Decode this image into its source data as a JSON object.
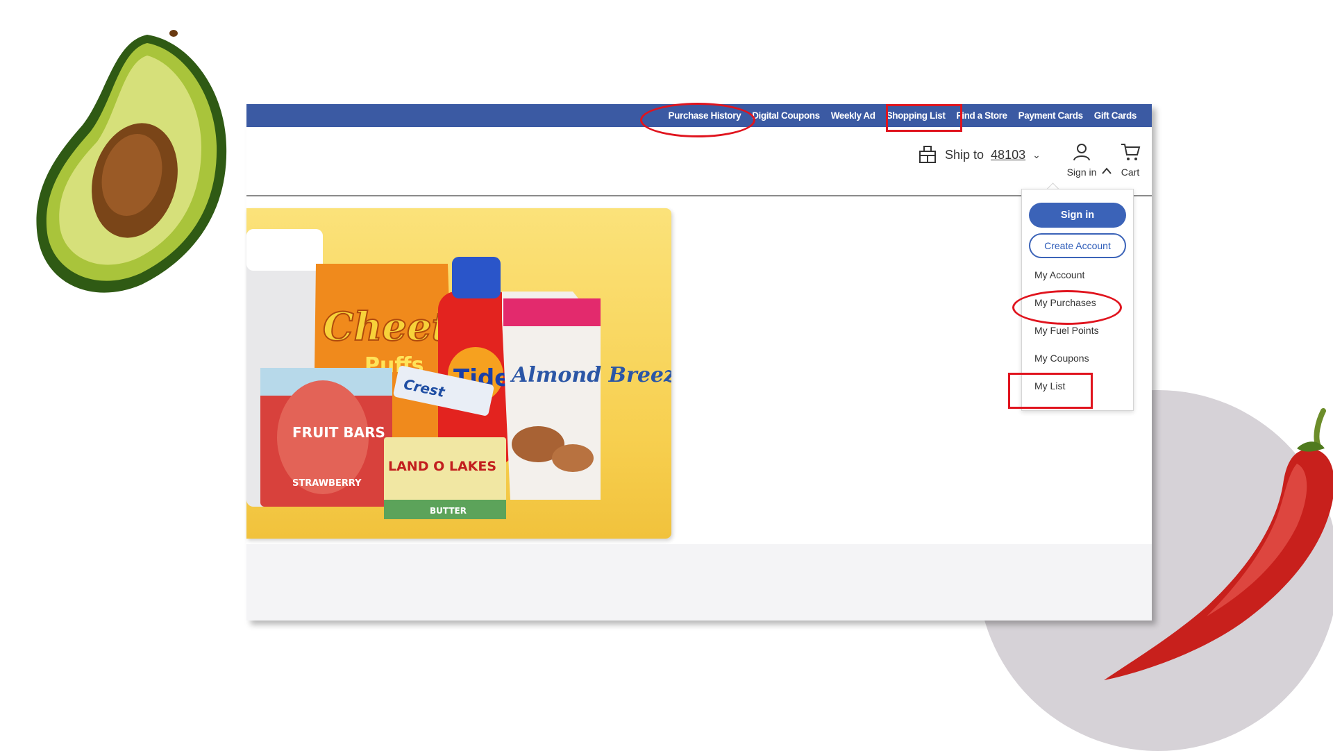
{
  "topnav": [
    "Purchase History",
    "Digital Coupons",
    "Weekly Ad",
    "Shopping List",
    "Find a Store",
    "Payment Cards",
    "Gift Cards"
  ],
  "header": {
    "ship_prefix": "Ship to",
    "ship_zip": "48103",
    "signin_label": "Sign in",
    "cart_label": "Cart"
  },
  "dropdown": {
    "signin_button": "Sign in",
    "create_account_button": "Create Account",
    "items": [
      "My Account",
      "My Purchases",
      "My Fuel Points",
      "My Coupons",
      "My List"
    ]
  },
  "hero": {
    "products": [
      "FRUIT BARS",
      "STRAWBERRY",
      "Cheetos",
      "Puffs",
      "Tide",
      "Almond Breeze",
      "Crest",
      "LAND O LAKES",
      "BUTTER"
    ]
  },
  "colors": {
    "nav_bar": "#3b5aa3",
    "primary_button": "#3b63b8",
    "annotation_red": "#e0141e"
  }
}
